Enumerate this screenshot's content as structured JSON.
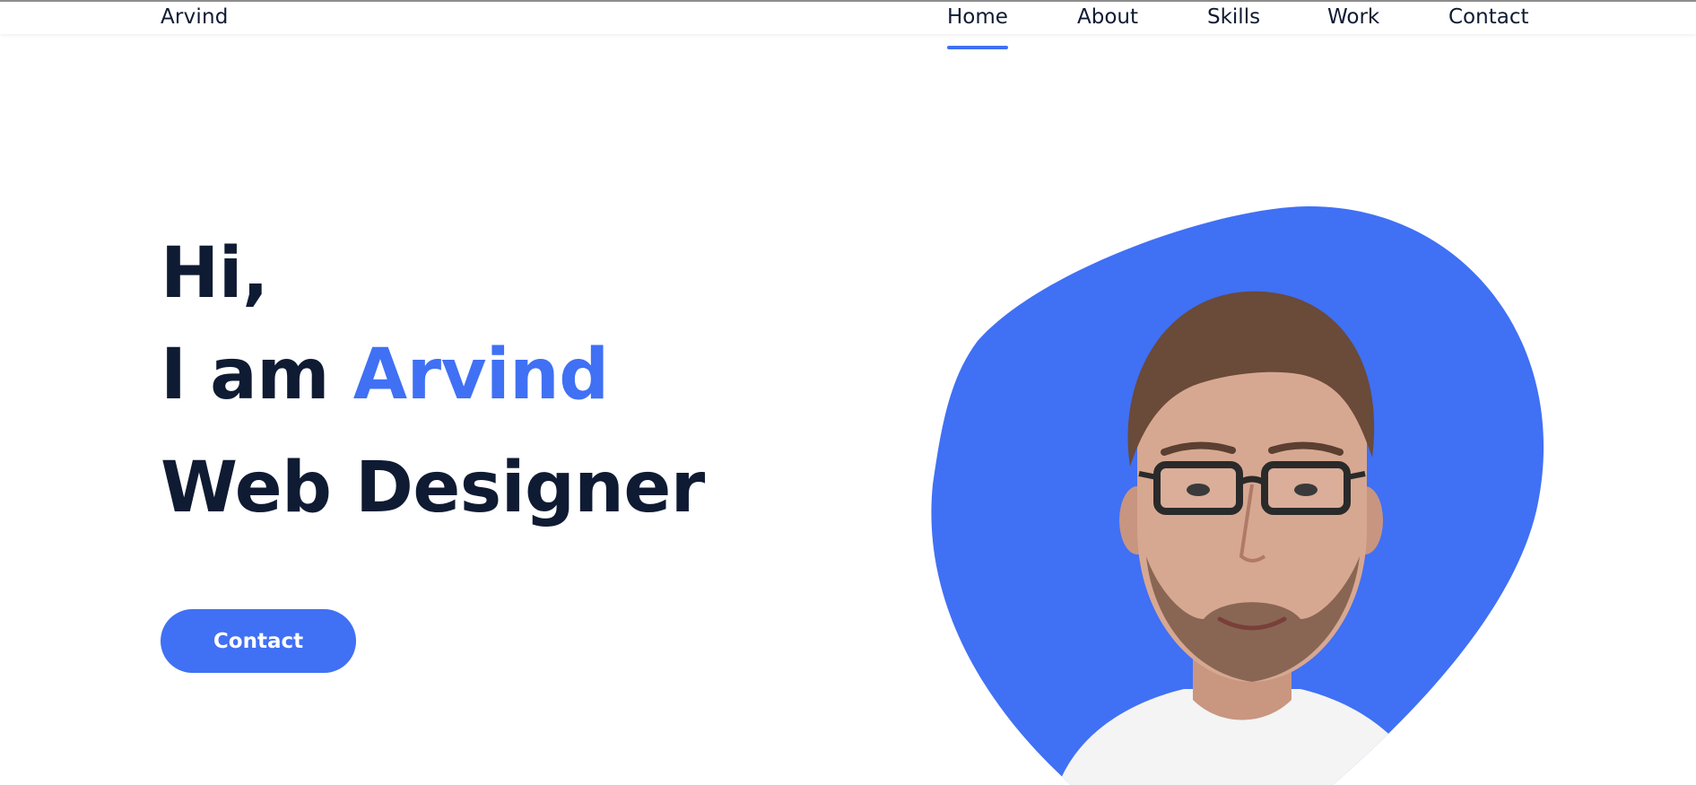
{
  "header": {
    "logo": "Arvind",
    "nav": [
      {
        "label": "Home",
        "active": true
      },
      {
        "label": "About",
        "active": false
      },
      {
        "label": "Skills",
        "active": false
      },
      {
        "label": "Work",
        "active": false
      },
      {
        "label": "Contact",
        "active": false
      }
    ]
  },
  "hero": {
    "greeting": "Hi,",
    "intro_prefix": "I am",
    "name": "Arvind",
    "role": "Web Designer",
    "cta_label": "Contact"
  },
  "colors": {
    "accent": "#4070f4",
    "text": "#0f1b33",
    "background": "#ffffff"
  },
  "portrait": {
    "icon": "person-portrait-photo"
  }
}
